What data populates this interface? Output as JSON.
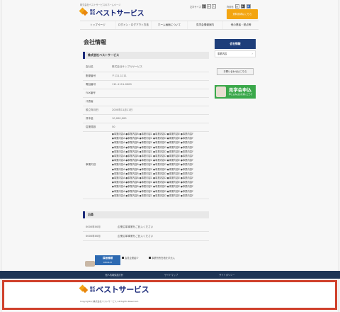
{
  "header": {
    "tagline": "株式会社ベストサービスのホームページ",
    "logo_kk_top": "株式",
    "logo_kk_bottom": "会社",
    "logo_name": "ベストサービス",
    "font_size_label": "文字サイズ",
    "font_sizes": [
      "小",
      "中",
      "大"
    ],
    "bg_color_label": "背景色",
    "bg_colors": [
      "白",
      "黒",
      "青"
    ],
    "cta_label": "資料請求はこちら"
  },
  "nav": {
    "items": [
      "トップページ",
      "ログイン・ログアウト方法",
      "ホーム画面について",
      "見学会情報案内",
      "他の業者・拠点等"
    ]
  },
  "main": {
    "page_title": "会社情報",
    "company_section_title": "株式会社ベストサービス",
    "rows": [
      {
        "label": "会社名",
        "value": "株式会社サンプルサービス"
      },
      {
        "label": "郵便番号",
        "value": "〒111-1111"
      },
      {
        "label": "電話番号",
        "value": "111-1111-0000"
      },
      {
        "label": "FAX番号",
        "value": ""
      },
      {
        "label": "代表者",
        "value": ""
      },
      {
        "label": "設立年月日",
        "value": "2000年11月11日"
      },
      {
        "label": "資本金",
        "value": "10,000,000"
      },
      {
        "label": "従業員数",
        "value": "50"
      }
    ],
    "business_label": "事業内容",
    "business_lines": [
      "●事業内容A ●事業内容B ●事業内容C ●事業内容D ●事業内容E ●事業内容F",
      "●事業内容A ●事業内容B ●事業内容C ●事業内容D ●事業内容E ●事業内容F",
      "●事業内容A ●事業内容B ●事業内容C ●事業内容D ●事業内容E ●事業内容F",
      "●事業内容A ●事業内容B ●事業内容C ●事業内容D ●事業内容E ●事業内容F",
      "●事業内容A ●事業内容B ●事業内容C ●事業内容D ●事業内容E ●事業内容F",
      "●事業内容A ●事業内容B ●事業内容C ●事業内容D ●事業内容E ●事業内容F",
      "●事業内容A ●事業内容B ●事業内容C ●事業内容D ●事業内容E ●事業内容F",
      "●事業内容A ●事業内容B ●事業内容C ●事業内容D ●事業内容E ●事業内容F",
      "●事業内容A ●事業内容B ●事業内容C ●事業内容D ●事業内容E ●事業内容F",
      "●事業内容A ●事業内容B ●事業内容C ●事業内容D ●事業内容E ●事業内容F",
      "●事業内容A ●事業内容B ●事業内容C ●事業内容D ●事業内容E ●事業内容F",
      "●事業内容A ●事業内容B ●事業内容C ●事業内容D ●事業内容E ●事業内容F",
      "●事業内容A ●事業内容B ●事業内容C ●事業内容D ●事業内容E ●事業内容F",
      "●事業内容A ●事業内容B ●事業内容C ●事業内容D ●事業内容E ●事業内容F",
      "●事業内容A ●事業内容B ●事業内容C ●事業内容D ●事業内容E ●事業内容F"
    ],
    "sales_section_title": "沿革",
    "sales_rows": [
      {
        "label": "0000年00月",
        "value": "企業沿革事業をご記入ください"
      },
      {
        "label": "0000年00月",
        "value": "企業沿革事業をご記入ください"
      }
    ],
    "badge_title": "採用情報",
    "badge_sub": "RECRUIT",
    "notes": [
      "会員企業紹介",
      "事業所所在地を手元入"
    ]
  },
  "sidebar": {
    "head": "会社情報",
    "row_label": "事業内容",
    "button_label": "お問い合わせはこちら",
    "banner_title": "見学会申込",
    "banner_sub": "申し込みはお気軽にどうぞ"
  },
  "footer": {
    "nav_items": [
      "個人情報保護方針",
      "サイトマップ",
      "サイトポリシー"
    ],
    "copyright": "Copyright(c)株式会社ベストサービス All Rights Reserved."
  },
  "colors": {
    "brand_navy": "#1b2a7a",
    "accent_orange": "#f3a511",
    "footer_highlight": "#d0412c",
    "banner_green": "#3aa84a"
  }
}
